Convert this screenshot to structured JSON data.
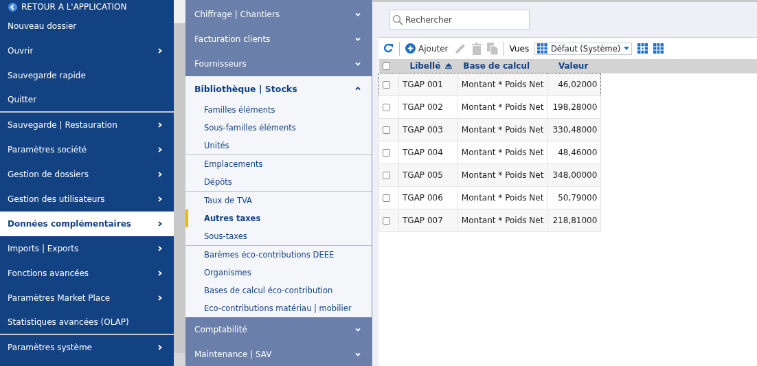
{
  "sidebar": {
    "back_link": "RETOUR A L'APPLICATION",
    "items": [
      {
        "label": "Nouveau dossier",
        "submenu": false,
        "selected": false,
        "group_end": false
      },
      {
        "label": "Ouvrir",
        "submenu": true,
        "selected": false,
        "group_end": false
      },
      {
        "label": "Sauvegarde rapide",
        "submenu": false,
        "selected": false,
        "group_end": false
      },
      {
        "label": "Quitter",
        "submenu": false,
        "selected": false,
        "group_end": true
      },
      {
        "label": "Sauvegarde | Restauration",
        "submenu": true,
        "selected": false,
        "group_end": false
      },
      {
        "label": "Paramètres société",
        "submenu": true,
        "selected": false,
        "group_end": false
      },
      {
        "label": "Gestion de dossiers",
        "submenu": true,
        "selected": false,
        "group_end": false
      },
      {
        "label": "Gestion des utilisateurs",
        "submenu": true,
        "selected": false,
        "group_end": false
      },
      {
        "label": "Données complémentaires",
        "submenu": true,
        "selected": true,
        "group_end": false
      },
      {
        "label": "Imports | Exports",
        "submenu": true,
        "selected": false,
        "group_end": false
      },
      {
        "label": "Fonctions avancées",
        "submenu": true,
        "selected": false,
        "group_end": false
      },
      {
        "label": "Paramètres Market Place",
        "submenu": true,
        "selected": false,
        "group_end": false
      },
      {
        "label": "Statistiques avancées (OLAP)",
        "submenu": false,
        "selected": false,
        "group_end": true
      },
      {
        "label": "Paramètres système",
        "submenu": true,
        "selected": false,
        "group_end": false
      }
    ]
  },
  "menu": {
    "sections": [
      {
        "label": "Chiffrage | Chantiers",
        "expanded": false
      },
      {
        "label": "Facturation clients",
        "expanded": false
      },
      {
        "label": "Fournisseurs",
        "expanded": false
      },
      {
        "label": "Bibliothèque | Stocks",
        "expanded": true,
        "groups": [
          [
            {
              "label": "Familles éléments",
              "selected": false
            },
            {
              "label": "Sous-familles éléments",
              "selected": false
            },
            {
              "label": "Unités",
              "selected": false
            }
          ],
          [
            {
              "label": "Emplacements",
              "selected": false
            },
            {
              "label": "Dépôts",
              "selected": false
            }
          ],
          [
            {
              "label": "Taux de TVA",
              "selected": false
            },
            {
              "label": "Autres taxes",
              "selected": true
            },
            {
              "label": "Sous-taxes",
              "selected": false
            }
          ],
          [
            {
              "label": "Barèmes éco-contributions DEEE",
              "selected": false
            },
            {
              "label": "Organismes",
              "selected": false
            },
            {
              "label": "Bases de calcul éco-contribution",
              "selected": false
            },
            {
              "label": "Eco-contributions matériau | mobilier",
              "selected": false
            }
          ]
        ]
      },
      {
        "label": "Comptabilité",
        "expanded": false
      },
      {
        "label": "Maintenance | SAV",
        "expanded": false
      }
    ]
  },
  "search": {
    "placeholder": "Rechercher"
  },
  "toolbar": {
    "buttons": [
      {
        "kind": "refresh",
        "disabled": false
      },
      {
        "kind": "add",
        "label": "Ajouter",
        "disabled": false
      },
      {
        "kind": "edit",
        "disabled": true
      },
      {
        "kind": "delete",
        "disabled": true
      },
      {
        "kind": "copy",
        "disabled": true
      }
    ],
    "views_label": "Vues",
    "view": "Défaut (Système)"
  },
  "table": {
    "all_checked": false,
    "columns": [
      {
        "label": "Libellé",
        "sorted": true
      },
      {
        "label": "Base de calcul",
        "sorted": false
      },
      {
        "label": "Valeur",
        "sorted": false
      }
    ],
    "rows": [
      {
        "checked": false,
        "focused": true,
        "cells": [
          "TGAP 001",
          "Montant * Poids Net",
          "46,02000"
        ]
      },
      {
        "checked": false,
        "focused": false,
        "cells": [
          "TGAP 002",
          "Montant * Poids Net",
          "198,28000"
        ]
      },
      {
        "checked": false,
        "focused": false,
        "cells": [
          "TGAP 003",
          "Montant * Poids Net",
          "330,48000"
        ]
      },
      {
        "checked": false,
        "focused": false,
        "cells": [
          "TGAP 004",
          "Montant * Poids Net",
          "48,46000"
        ]
      },
      {
        "checked": false,
        "focused": false,
        "cells": [
          "TGAP 005",
          "Montant * Poids Net",
          "348,00000"
        ]
      },
      {
        "checked": false,
        "focused": false,
        "cells": [
          "TGAP 006",
          "Montant * Poids Net",
          "50,79000"
        ]
      },
      {
        "checked": false,
        "focused": false,
        "cells": [
          "TGAP 007",
          "Montant * Poids Net",
          "218,81000"
        ]
      }
    ]
  }
}
